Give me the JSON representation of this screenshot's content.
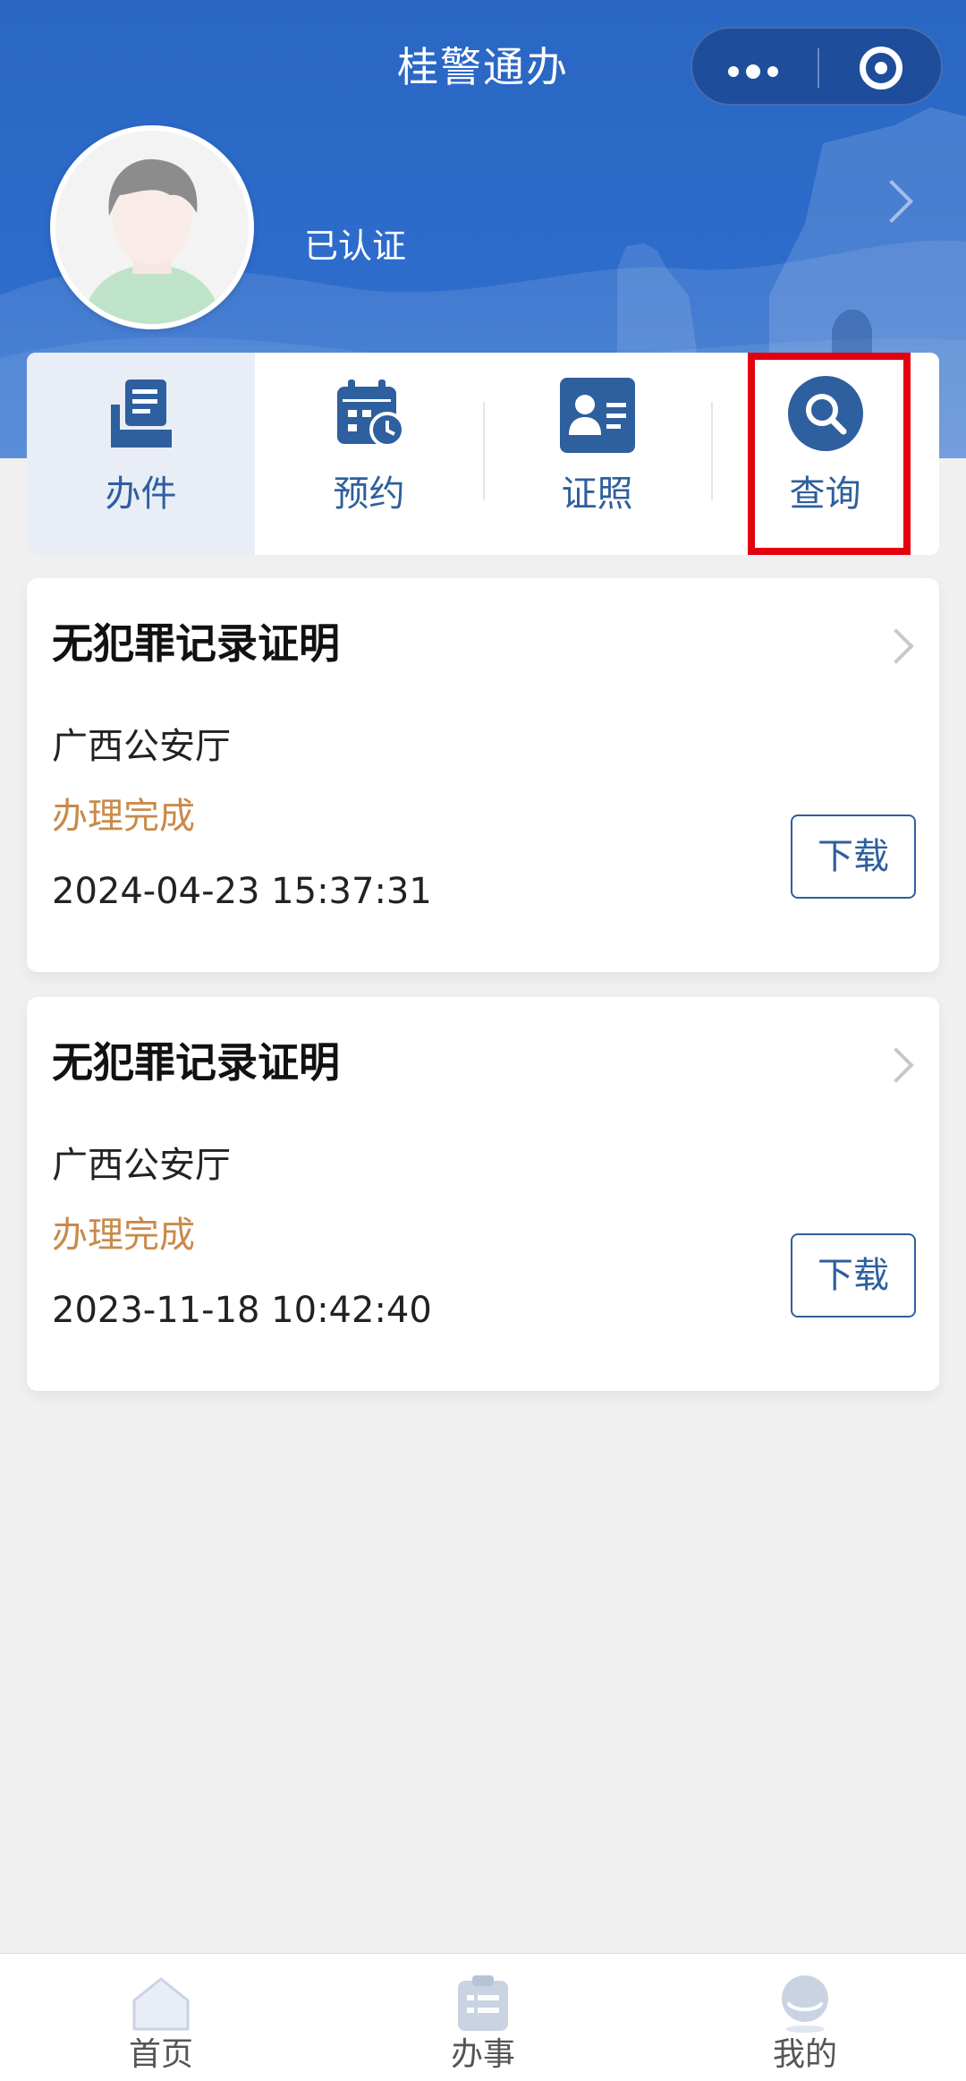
{
  "header": {
    "title": "桂警通办",
    "verified_label": "已认证"
  },
  "quick_actions": [
    {
      "label": "办件",
      "icon": "document-stack-icon",
      "active": true
    },
    {
      "label": "预约",
      "icon": "calendar-clock-icon",
      "active": false
    },
    {
      "label": "证照",
      "icon": "id-card-icon",
      "active": false
    },
    {
      "label": "查询",
      "icon": "search-icon",
      "active": false
    }
  ],
  "records": [
    {
      "title": "无犯罪记录证明",
      "department": "广西公安厅",
      "status": "办理完成",
      "time": "2024-04-23 15:37:31",
      "download_label": "下载"
    },
    {
      "title": "无犯罪记录证明",
      "department": "广西公安厅",
      "status": "办理完成",
      "time": "2023-11-18 10:42:40",
      "download_label": "下载"
    }
  ],
  "tabbar": [
    {
      "label": "首页",
      "icon": "home-icon"
    },
    {
      "label": "办事",
      "icon": "clipboard-icon"
    },
    {
      "label": "我的",
      "icon": "user-icon"
    }
  ],
  "colors": {
    "header_blue": "#2a67c4",
    "accent_blue": "#2e5f9e",
    "status_orange": "#c98a4a",
    "highlight_red": "#e3000f"
  }
}
